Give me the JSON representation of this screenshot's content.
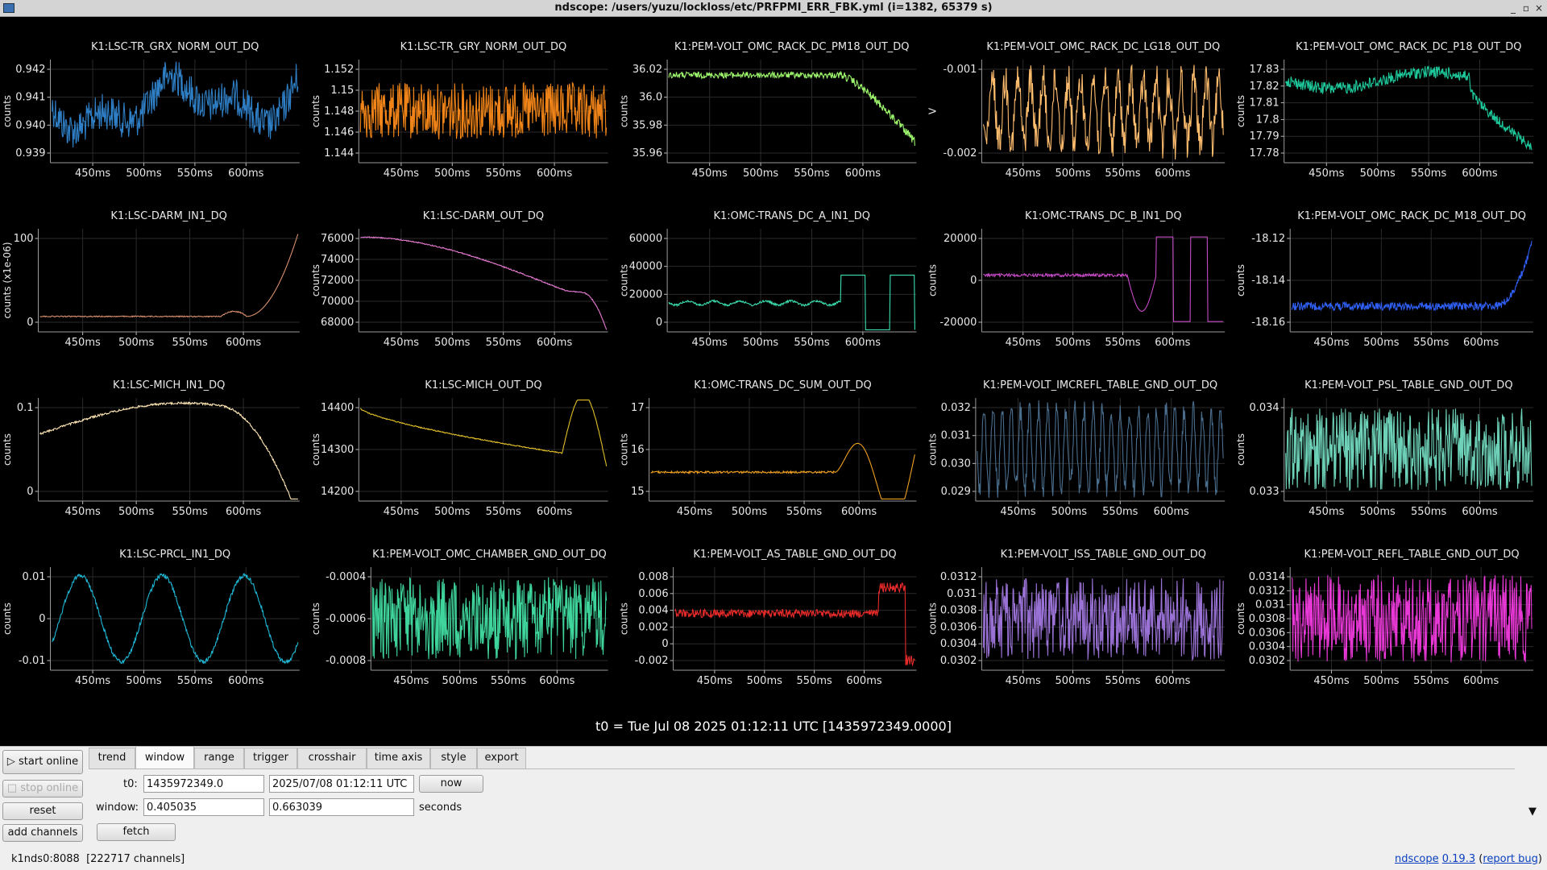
{
  "window": {
    "title": "ndscope: /users/yuzu/lockloss/etc/PRFPMI_ERR_FBK.yml (i=1382, 65379 s)",
    "buttons": {
      "minimize": "_",
      "maximize": "▫",
      "close": "×"
    }
  },
  "xticks": [
    "450ms",
    "500ms",
    "550ms",
    "600ms"
  ],
  "plots": [
    {
      "title": "K1:LSC-TR_GRX_NORM_OUT_DQ",
      "ylabel": "counts",
      "color": "#2f7fc6",
      "yticks": [
        "0.942",
        "0.941",
        "0.940",
        "0.939"
      ]
    },
    {
      "title": "K1:LSC-TR_GRY_NORM_OUT_DQ",
      "ylabel": "counts",
      "color": "#f08418",
      "yticks": [
        "1.152",
        "1.15",
        "1.148",
        "1.146",
        "1.144"
      ]
    },
    {
      "title": "K1:PEM-VOLT_OMC_RACK_DC_PM18_OUT_DQ",
      "ylabel": "counts",
      "color": "#9cf56c",
      "yticks": [
        "36.02",
        "36.0",
        "35.98",
        "35.96"
      ]
    },
    {
      "title": "K1:PEM-VOLT_OMC_RACK_DC_LG18_OUT_DQ",
      "ylabel": "V",
      "color": "#ffbd6e",
      "yticks": [
        "-0.001",
        "-0.002"
      ]
    },
    {
      "title": "K1:PEM-VOLT_OMC_RACK_DC_P18_OUT_DQ",
      "ylabel": "counts",
      "color": "#1ec79a",
      "yticks": [
        "17.83",
        "17.82",
        "17.81",
        "17.8",
        "17.79",
        "17.78"
      ]
    },
    {
      "title": "K1:LSC-DARM_IN1_DQ",
      "ylabel": "counts (x1e-06)",
      "color": "#d98f6e",
      "yticks": [
        "100",
        "0"
      ]
    },
    {
      "title": "K1:LSC-DARM_OUT_DQ",
      "ylabel": "counts",
      "color": "#e67ad2",
      "yticks": [
        "76000",
        "74000",
        "72000",
        "70000",
        "68000"
      ]
    },
    {
      "title": "K1:OMC-TRANS_DC_A_IN1_DQ",
      "ylabel": "counts",
      "color": "#3be0b0",
      "yticks": [
        "60000",
        "40000",
        "20000",
        "0"
      ]
    },
    {
      "title": "K1:OMC-TRANS_DC_B_IN1_DQ",
      "ylabel": "counts",
      "color": "#c64ac6",
      "yticks": [
        "20000",
        "0",
        "-20000"
      ]
    },
    {
      "title": "K1:PEM-VOLT_OMC_RACK_DC_M18_OUT_DQ",
      "ylabel": "counts",
      "color": "#2f5ff5",
      "yticks": [
        "-18.12",
        "-18.14",
        "-18.16"
      ]
    },
    {
      "title": "K1:LSC-MICH_IN1_DQ",
      "ylabel": "counts",
      "color": "#ffe6b4",
      "yticks": [
        "0.1",
        "0"
      ]
    },
    {
      "title": "K1:LSC-MICH_OUT_DQ",
      "ylabel": "counts",
      "color": "#e0bf28",
      "yticks": [
        "14400",
        "14300",
        "14200"
      ]
    },
    {
      "title": "K1:OMC-TRANS_DC_SUM_OUT_DQ",
      "ylabel": "counts",
      "color": "#f0a020",
      "yticks": [
        "17",
        "16",
        "15"
      ]
    },
    {
      "title": "K1:PEM-VOLT_IMCREFL_TABLE_GND_OUT_DQ",
      "ylabel": "counts",
      "color": "#4a6e8e",
      "yticks": [
        "0.032",
        "0.031",
        "0.030",
        "0.029"
      ]
    },
    {
      "title": "K1:PEM-VOLT_PSL_TABLE_GND_OUT_DQ",
      "ylabel": "counts",
      "color": "#6ed2b8",
      "yticks": [
        "0.034",
        "0.033"
      ]
    },
    {
      "title": "K1:LSC-PRCL_IN1_DQ",
      "ylabel": "counts",
      "color": "#1fb8d6",
      "yticks": [
        "0.01",
        "0",
        "-0.01"
      ]
    },
    {
      "title": "K1:PEM-VOLT_OMC_CHAMBER_GND_OUT_DQ",
      "ylabel": "counts",
      "color": "#3fd49c",
      "yticks": [
        "-0.0004",
        "-0.0006",
        "-0.0008"
      ]
    },
    {
      "title": "K1:PEM-VOLT_AS_TABLE_GND_OUT_DQ",
      "ylabel": "counts",
      "color": "#e62a2a",
      "yticks": [
        "0.008",
        "0.006",
        "0.004",
        "0.002",
        "0",
        "-0.002"
      ]
    },
    {
      "title": "K1:PEM-VOLT_ISS_TABLE_GND_OUT_DQ",
      "ylabel": "counts",
      "color": "#9a72d6",
      "yticks": [
        "0.0312",
        "0.031",
        "0.0308",
        "0.0306",
        "0.0304",
        "0.0302"
      ]
    },
    {
      "title": "K1:PEM-VOLT_REFL_TABLE_GND_OUT_DQ",
      "ylabel": "counts",
      "color": "#e838d6",
      "yticks": [
        "0.0314",
        "0.0312",
        "0.031",
        "0.0308",
        "0.0306",
        "0.0304",
        "0.0302"
      ]
    }
  ],
  "t0_label": "t0 = Tue Jul 08 2025 01:12:11 UTC [1435972349.0000]",
  "side_buttons": {
    "start_online": "▷ start online",
    "stop_online": "□ stop online",
    "reset": "reset",
    "add_channels": "add channels"
  },
  "tabs": [
    "trend",
    "window",
    "range",
    "trigger",
    "crosshair",
    "time axis",
    "style",
    "export"
  ],
  "active_tab": "window",
  "window_panel": {
    "t0_label": "t0:",
    "t0_gps": "1435972349.0",
    "t0_utc": "2025/07/08 01:12:11 UTC",
    "now_button": "now",
    "window_label": "window:",
    "window_start": "0.405035",
    "window_end": "0.663039",
    "seconds_label": "seconds",
    "fetch_button": "fetch",
    "collapse_icon": "▼"
  },
  "status": {
    "server": "k1nds0:8088",
    "channels": "[222717 channels]",
    "app_link": "ndscope",
    "version": "0.19.3",
    "report_bug": "report bug"
  }
}
